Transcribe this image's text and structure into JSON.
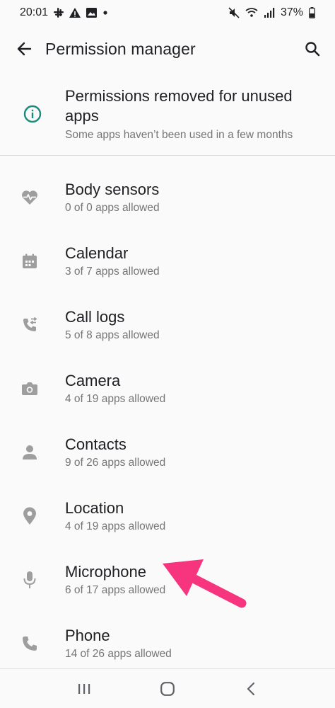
{
  "status": {
    "time": "20:01",
    "battery": "37%"
  },
  "header": {
    "title": "Permission manager"
  },
  "banner": {
    "title": "Permissions removed for unused apps",
    "subtitle": "Some apps haven’t been used in a few months",
    "icon": "info-icon",
    "accent": "#1b8a7a"
  },
  "permissions": [
    {
      "label": "Body sensors",
      "summary": "0 of 0 apps allowed",
      "icon": "heart-pulse-icon"
    },
    {
      "label": "Calendar",
      "summary": "3 of 7 apps allowed",
      "icon": "calendar-icon"
    },
    {
      "label": "Call logs",
      "summary": "5 of 8 apps allowed",
      "icon": "call-log-icon"
    },
    {
      "label": "Camera",
      "summary": "4 of 19 apps allowed",
      "icon": "camera-icon"
    },
    {
      "label": "Contacts",
      "summary": "9 of 26 apps allowed",
      "icon": "person-icon"
    },
    {
      "label": "Location",
      "summary": "4 of 19 apps allowed",
      "icon": "location-pin-icon"
    },
    {
      "label": "Microphone",
      "summary": "6 of 17 apps allowed",
      "icon": "microphone-icon"
    },
    {
      "label": "Phone",
      "summary": "14 of 26 apps allowed",
      "icon": "phone-icon"
    }
  ],
  "colors": {
    "icon_gray": "#9e9e9e",
    "annotation_arrow": "#f7357f"
  }
}
